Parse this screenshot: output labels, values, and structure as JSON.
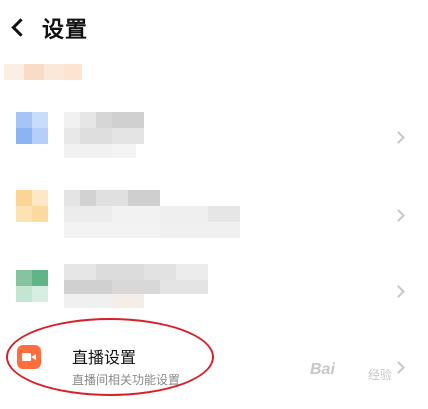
{
  "header": {
    "title": "设置"
  },
  "live_row": {
    "title": "直播设置",
    "subtitle": "直播间相关功能设置",
    "icon_color": "#ff6e3c"
  },
  "watermark": {
    "brand": "Bai",
    "brand2": "经验"
  },
  "icons": {
    "back": "chevron-left-icon",
    "live": "video-camera-icon",
    "row_arrow": "chevron-right-icon"
  },
  "colors": {
    "accent": "#ff6e3c",
    "highlight": "#d8202b",
    "subtitle": "#8a8a8a"
  }
}
